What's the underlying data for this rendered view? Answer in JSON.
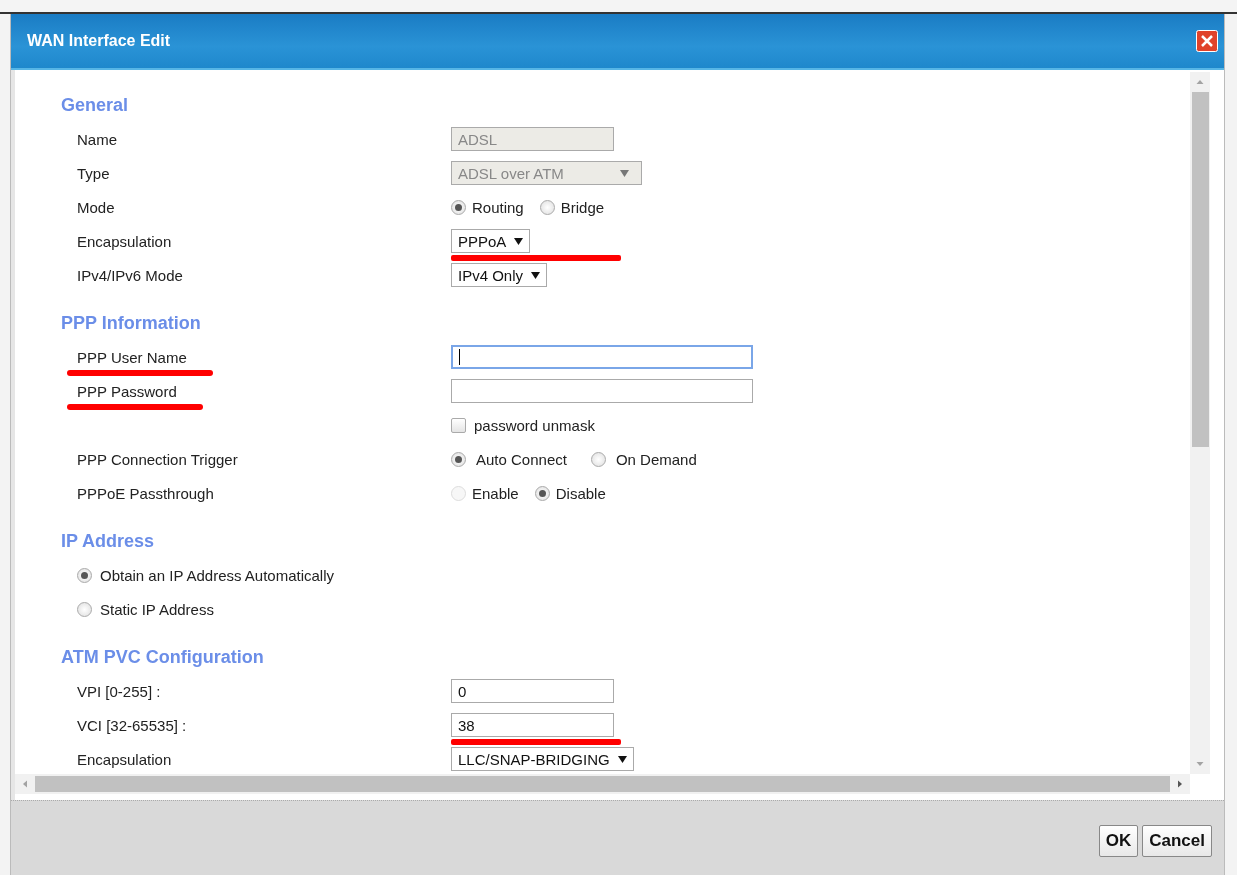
{
  "dialog": {
    "title": "WAN Interface Edit"
  },
  "sections": [
    {
      "title": "General",
      "rows": [
        {
          "kind": "text",
          "label": "Name",
          "value": "ADSL",
          "disabled": true
        },
        {
          "kind": "select",
          "label": "Type",
          "value": "ADSL over ATM",
          "disabled": true
        },
        {
          "kind": "radios",
          "label": "Mode",
          "options": [
            {
              "label": "Routing",
              "selected": true,
              "disabled": false
            },
            {
              "label": "Bridge",
              "selected": false,
              "disabled": false
            }
          ]
        },
        {
          "kind": "select",
          "label": "Encapsulation",
          "value": "PPPoA",
          "disabled": false,
          "control_underlined": true
        },
        {
          "kind": "select",
          "label": "IPv4/IPv6 Mode",
          "value": "IPv4 Only",
          "disabled": false
        }
      ]
    },
    {
      "title": "PPP Information",
      "rows": [
        {
          "kind": "input",
          "label": "PPP User Name",
          "focused": true,
          "label_underlined": true
        },
        {
          "kind": "input",
          "label": "PPP Password",
          "focused": false,
          "label_underlined": true
        },
        {
          "kind": "checkbox",
          "text": "password unmask",
          "checked": false
        },
        {
          "kind": "radios",
          "label": "PPP Connection Trigger",
          "options": [
            {
              "label": "Auto Connect",
              "selected": true,
              "disabled": false
            },
            {
              "label": "On Demand",
              "selected": false,
              "disabled": false
            }
          ]
        },
        {
          "kind": "radios",
          "label": "PPPoE Passthrough",
          "options": [
            {
              "label": "Enable",
              "selected": false,
              "disabled": true
            },
            {
              "label": "Disable",
              "selected": true,
              "disabled": false
            }
          ]
        }
      ]
    },
    {
      "title": "IP Address",
      "rows": [
        {
          "kind": "radio_option",
          "text": "Obtain an IP Address Automatically",
          "selected": true
        },
        {
          "kind": "radio_option",
          "text": "Static IP Address",
          "selected": false
        }
      ]
    },
    {
      "title": "ATM PVC Configuration",
      "rows": [
        {
          "kind": "input",
          "label": "VPI [0-255] :",
          "value": "0",
          "focused": false
        },
        {
          "kind": "input",
          "label": "VCI [32-65535] :",
          "value": "38",
          "focused": false,
          "control_underlined": true
        },
        {
          "kind": "select",
          "label": "Encapsulation",
          "value": "LLC/SNAP-BRIDGING",
          "disabled": false
        }
      ]
    }
  ],
  "buttons": [
    {
      "label": "OK"
    },
    {
      "label": "Cancel"
    }
  ]
}
